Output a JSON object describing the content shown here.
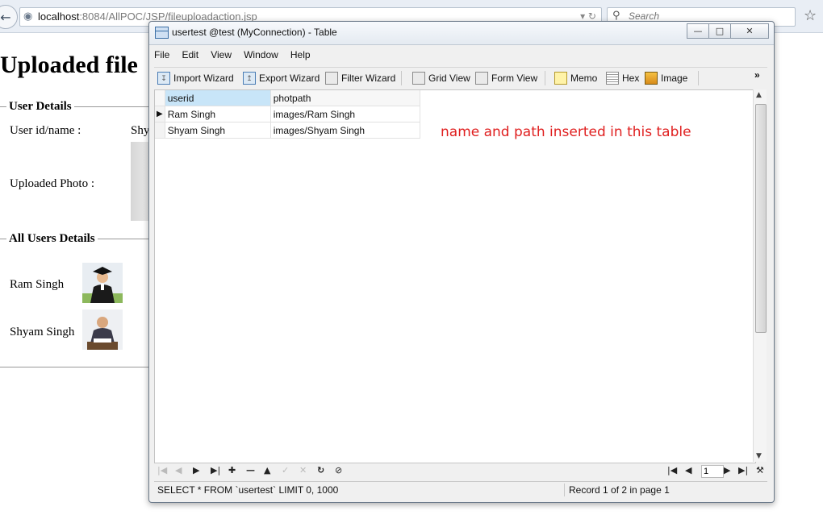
{
  "browser": {
    "url_host": "localhost",
    "url_path": ":8084/AllPOC/JSP/fileuploadaction.jsp",
    "search_placeholder": "Search"
  },
  "page": {
    "title": "Uploaded file",
    "user_details_legend": "User Details",
    "user_id_label": "User id/name :",
    "user_id_value": "Shy",
    "uploaded_photo_label": "Uploaded Photo :",
    "all_users_legend": "All Users Details",
    "users": [
      {
        "name": "Ram Singh",
        "photo_icon": "graduate-photo"
      },
      {
        "name": "Shyam Singh",
        "photo_icon": "office-worker-photo"
      }
    ]
  },
  "window": {
    "title": "usertest @test (MyConnection) - Table",
    "menu": [
      "File",
      "Edit",
      "View",
      "Window",
      "Help"
    ],
    "toolbar": {
      "import_wizard": "Import Wizard",
      "export_wizard": "Export Wizard",
      "filter_wizard": "Filter Wizard",
      "grid_view": "Grid View",
      "form_view": "Form View",
      "memo": "Memo",
      "hex": "Hex",
      "image": "Image",
      "overflow": "»"
    },
    "grid": {
      "columns": [
        "userid",
        "photpath"
      ],
      "rows": [
        [
          "Ram Singh",
          "images/Ram Singh"
        ],
        [
          "Shyam Singh",
          "images/Shyam Singh"
        ]
      ]
    },
    "annotation": "name and path inserted in this table",
    "nav": {
      "page": "1"
    },
    "status": {
      "sql": "SELECT * FROM `usertest` LIMIT 0, 1000",
      "record": "Record 1 of 2 in page 1"
    }
  }
}
